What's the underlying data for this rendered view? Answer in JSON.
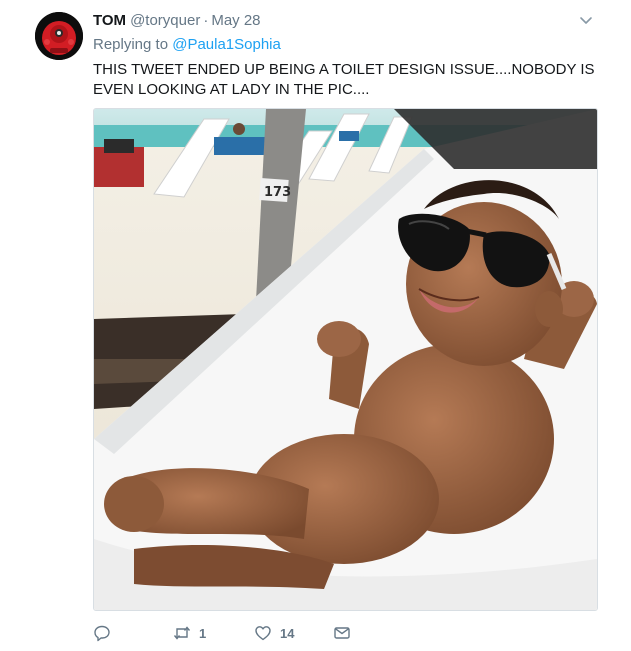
{
  "tweet": {
    "author_name": "TOM",
    "author_handle": "@toryquer",
    "separator": "·",
    "timestamp": "May 28",
    "replying_prefix": "Replying to",
    "replying_to": "@Paula1Sophia",
    "text": "THIS TWEET ENDED UP BEING A TOILET DESIGN ISSUE....NOBODY IS EVEN LOOKING AT LADY IN THE PIC....",
    "media_sign_text": "173"
  },
  "actions": {
    "reply_count": "",
    "retweet_count": "1",
    "like_count": "14"
  },
  "icons": {
    "caret": "chevron-down-icon",
    "reply": "reply-icon",
    "retweet": "retweet-icon",
    "like": "heart-icon",
    "message": "envelope-icon"
  },
  "colors": {
    "link": "#1da1f2",
    "secondary_text": "#657786",
    "primary_text": "#14171a",
    "avatar_accent": "#e0202a"
  }
}
